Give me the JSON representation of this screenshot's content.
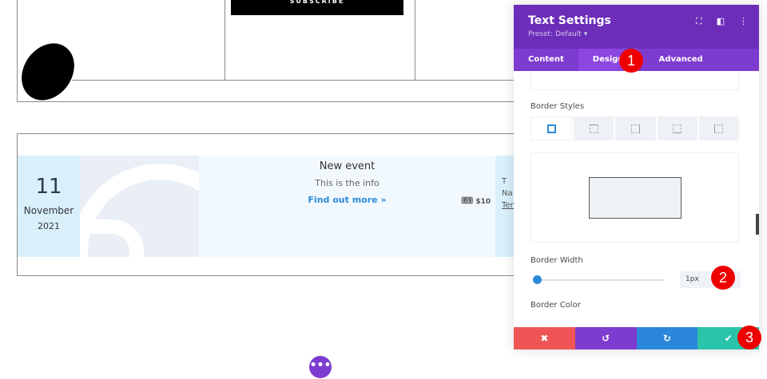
{
  "canvas": {
    "subscribe_label": "SUBSCRIBE",
    "event": {
      "day": "11",
      "month": "November",
      "year": "2021",
      "title": "New event",
      "info": "This is the info",
      "link": "Find out more »",
      "price": "$10",
      "side_lines": [
        "T",
        "Na",
        "Ten"
      ]
    },
    "more_button": "•••"
  },
  "panel": {
    "title": "Text Settings",
    "preset": "Preset: Default ▾",
    "header_icons": [
      "fullscreen-icon",
      "split-view-icon",
      "more-vertical-icon"
    ],
    "tabs": [
      {
        "label": "Content"
      },
      {
        "label": "Design",
        "active": true
      },
      {
        "label": "Advanced"
      }
    ],
    "border_styles_label": "Border Styles",
    "border_width_label": "Border Width",
    "border_width_value": "1px",
    "border_width_level": 1,
    "border_color_label": "Border Color",
    "swatches": [
      "#000000",
      "#ffffff",
      "#e02b20",
      "#e09900",
      "#edf000",
      "#7cda24",
      "#0c71c3",
      "#8300e9"
    ],
    "footer": {
      "cancel": "✖",
      "undo": "↺",
      "redo": "↻",
      "save": "✔"
    },
    "colors": {
      "header": "#6c2eb9",
      "tabs": "#7e3bd0",
      "cancel": "#ef5555",
      "undo": "#7e3bd0",
      "redo": "#2b87da",
      "save": "#29c4a9"
    }
  },
  "annotations": [
    "1",
    "2",
    "3"
  ]
}
